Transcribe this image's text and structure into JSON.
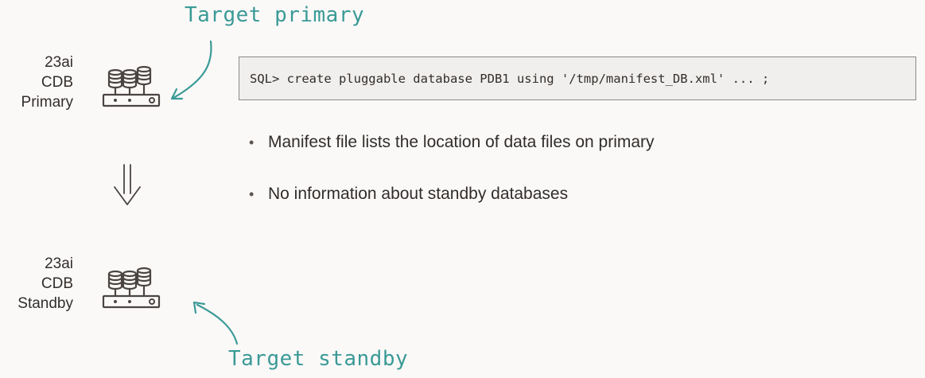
{
  "primary": {
    "label_lines": [
      "23ai",
      "CDB",
      "Primary"
    ],
    "callout": "Target primary",
    "icon": "database-server-icon"
  },
  "standby": {
    "label_lines": [
      "23ai",
      "CDB",
      "Standby"
    ],
    "callout": "Target standby",
    "icon": "database-server-icon"
  },
  "sql_command": "SQL> create pluggable database PDB1 using '/tmp/manifest_DB.xml' ... ;",
  "bullets": [
    "Manifest file lists the location of data files on primary",
    "No information about standby databases"
  ],
  "colors": {
    "callout": "#3a9a96",
    "text": "#312d2a",
    "background": "#fbf9f8",
    "code_box": "#f1efed"
  },
  "arrow_icon": "double-down-arrow-icon"
}
